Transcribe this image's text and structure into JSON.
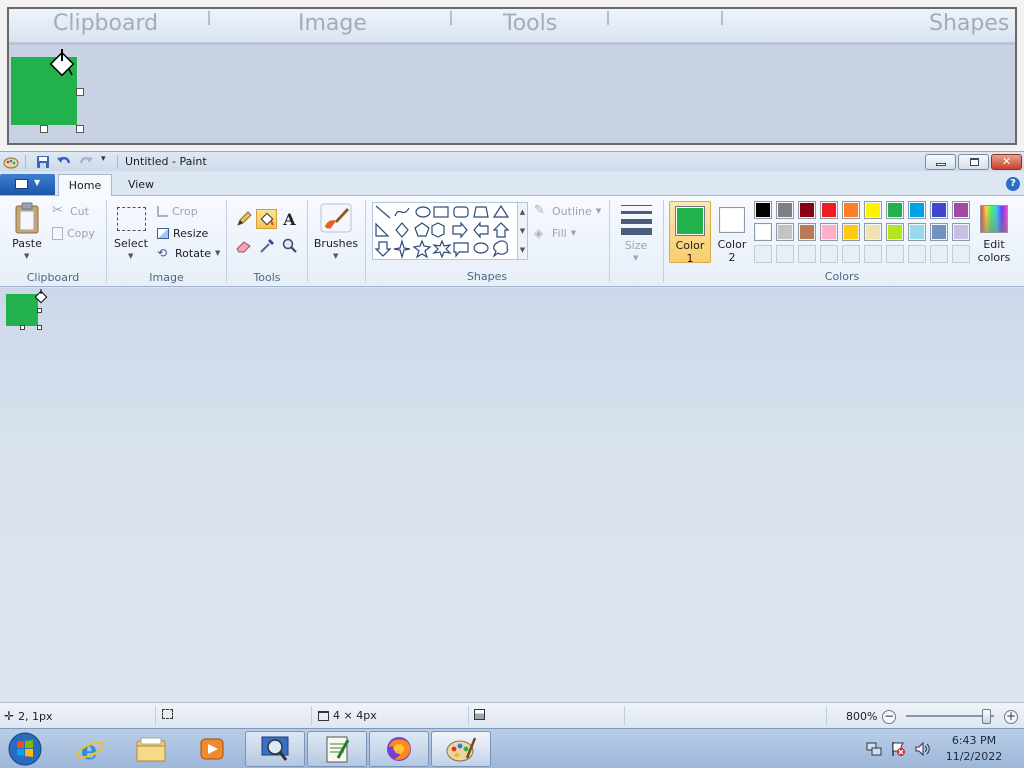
{
  "magnifier": {
    "labels": [
      "Clipboard",
      "Image",
      "Tools",
      "Shapes"
    ]
  },
  "window": {
    "title": "Untitled - Paint"
  },
  "tabs": [
    {
      "label": "Home",
      "active": true
    },
    {
      "label": "View",
      "active": false
    }
  ],
  "help": "?",
  "ribbon": {
    "clipboard": {
      "group_label": "Clipboard",
      "paste": "Paste",
      "cut": "Cut",
      "copy": "Copy"
    },
    "image": {
      "group_label": "Image",
      "select": "Select",
      "crop": "Crop",
      "resize": "Resize",
      "rotate": "Rotate"
    },
    "tools": {
      "group_label": "Tools",
      "active_tool": "fill"
    },
    "brushes": {
      "label": "Brushes"
    },
    "shapes": {
      "group_label": "Shapes",
      "outline": "Outline",
      "fill": "Fill"
    },
    "size": {
      "label": "Size"
    },
    "colors": {
      "group_label": "Colors",
      "color1_label_a": "Color",
      "color1_label_b": "1",
      "color2_label_a": "Color",
      "color2_label_b": "2",
      "edit_a": "Edit",
      "edit_b": "colors",
      "color1": "#22b14c",
      "color2": "#ffffff",
      "palette_row1": [
        "#000000",
        "#7f7f7f",
        "#880015",
        "#ed1c24",
        "#ff7f27",
        "#fff200",
        "#22b14c",
        "#00a2e8",
        "#3f48cc",
        "#a349a4"
      ],
      "palette_row2": [
        "#ffffff",
        "#c3c3c3",
        "#b97a57",
        "#ffaec9",
        "#ffc90e",
        "#efe4b0",
        "#b5e61d",
        "#99d9ea",
        "#7092be",
        "#c8bfe7"
      ],
      "palette_row3": [
        "",
        "",
        "",
        "",
        "",
        "",
        "",
        "",
        "",
        ""
      ]
    }
  },
  "canvas": {
    "fill_color": "#22b14c"
  },
  "status": {
    "cursor_pos": "2, 1px",
    "image_size": "4 × 4px",
    "zoom": "800%"
  },
  "taskbar": {
    "time": "6:43 PM",
    "date": "11/2/2022"
  }
}
